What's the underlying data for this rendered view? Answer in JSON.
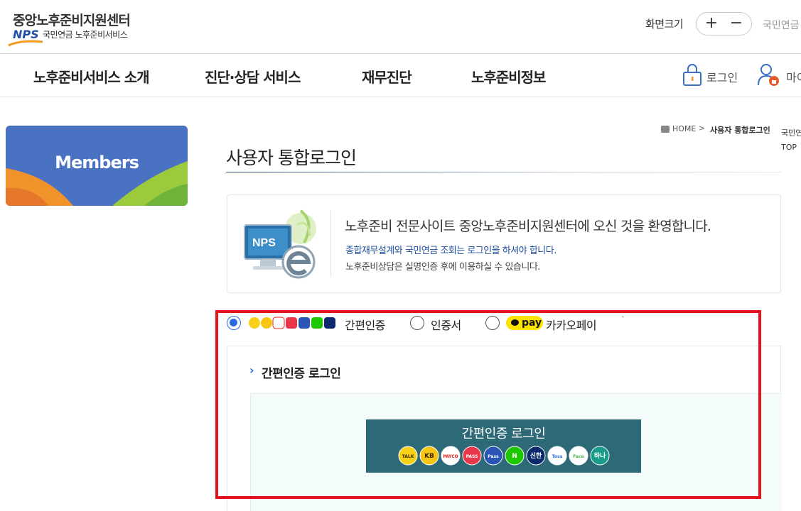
{
  "header": {
    "logo_title": "중앙노후준비지원센터",
    "logo_nps": "NPS",
    "logo_sub": "국민연금 노후준비서비스",
    "zoom_label": "화면크기",
    "zoom_plus": "+",
    "zoom_minus": "−",
    "top_link": "국민연금"
  },
  "nav": {
    "items": [
      {
        "label": "노후준비서비스 소개"
      },
      {
        "label": "진단·상담 서비스"
      },
      {
        "label": "재무진단"
      },
      {
        "label": "노후준비정보"
      }
    ],
    "login_label": "로그인",
    "my_label": "마이"
  },
  "sidebar": {
    "banner_title": "Members"
  },
  "breadcrumb": {
    "home": "HOME",
    "separator": ">",
    "current": "사용자 통합로그인"
  },
  "side_float": {
    "line1": "국민연",
    "line2": "TOP"
  },
  "page": {
    "title": "사용자 통합로그인"
  },
  "welcome": {
    "art_label": "NPS",
    "main": "노후준비 전문사이트 중앙노후준비지원센터에 오신 것을 환영합니다.",
    "blue": "종합재무설계와 국민연금 조회는 로그인을 하셔야 합니다.",
    "gray": "노후준비상담은 실명인증 후에 이용하실 수 있습니다."
  },
  "auth_options": {
    "selected": "simple",
    "simple_label": "간편인증",
    "cert_label": "인증서",
    "kakao_badge": "pay",
    "kakao_label": "카카오페이",
    "tick": "`"
  },
  "login_panel": {
    "title": "간편인증 로그인",
    "banner_title": "간편인증 로그인",
    "providers": [
      {
        "name": "TALK",
        "color": "#f7d117",
        "text_color": "#3a2a00"
      },
      {
        "name": "KB",
        "color": "#f7c514",
        "text_color": "#3a2a00"
      },
      {
        "name": "PAYCO",
        "color": "#ffffff",
        "text_color": "#e2231a"
      },
      {
        "name": "PASS",
        "color": "#e8374a",
        "text_color": "#ffffff"
      },
      {
        "name": "Pass",
        "color": "#2b55b4",
        "text_color": "#ffffff"
      },
      {
        "name": "N",
        "color": "#1ec800",
        "text_color": "#ffffff"
      },
      {
        "name": "신한",
        "color": "#0b2a6b",
        "text_color": "#ffffff"
      },
      {
        "name": "Toss",
        "color": "#ffffff",
        "text_color": "#2b6ddf"
      },
      {
        "name": "Face",
        "color": "#ffffff",
        "text_color": "#3bb54a"
      },
      {
        "name": "하나",
        "color": "#1a9c8a",
        "text_color": "#ffffff"
      }
    ]
  },
  "colors": {
    "accent": "#2b6ddf",
    "highlight_frame": "#e3131c",
    "banner": "#2e6978",
    "sidebar_banner": "#4a72c3"
  }
}
